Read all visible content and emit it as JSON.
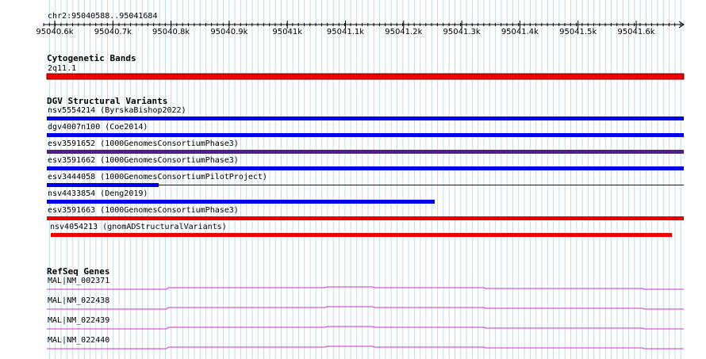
{
  "ruler": {
    "region_label": "chr2:95040588..95041684",
    "ticks": [
      "95040.6k",
      "95040.7k",
      "95040.8k",
      "95040.9k",
      "95041k",
      "95041.1k",
      "95041.2k",
      "95041.3k",
      "95041.4k",
      "95041.5k",
      "95041.6k"
    ]
  },
  "cytoband": {
    "title": "Cytogenetic Bands",
    "feature_label": "2q11.1",
    "color": "#ee0000"
  },
  "dgv": {
    "title": "DGV Structural Variants",
    "items": [
      {
        "label": "nsv5554214 (ByrskaBishop2022)",
        "color": "#0000ee"
      },
      {
        "label": "dgv4007n100 (Coe2014)",
        "color": "#0000ee"
      },
      {
        "label": "esv3591652 (1000GenomesConsortiumPhase3)",
        "color": "#551a8b"
      },
      {
        "label": "esv3591662 (1000GenomesConsortiumPhase3)",
        "color": "#0000ee"
      },
      {
        "label": "esv3444058 (1000GenomesConsortiumPilotProject)",
        "color": "#0000ee"
      },
      {
        "label": "nsv4433854 (Deng2019)",
        "color": "#0000ee"
      },
      {
        "label": "esv3591663 (1000GenomesConsortiumPhase3)",
        "color": "#ee0000"
      },
      {
        "label": "nsv4054213 (gnomADStructuralVariants)",
        "color": "#ee0000"
      }
    ]
  },
  "refseq": {
    "title": "RefSeq Genes",
    "color": "#cc33cc",
    "items": [
      {
        "label": "MAL|NM_002371"
      },
      {
        "label": "MAL|NM_022438"
      },
      {
        "label": "MAL|NM_022439"
      },
      {
        "label": "MAL|NM_022440"
      }
    ]
  },
  "colors": {
    "grid": "#c2dde6",
    "ruler": "#000000"
  }
}
